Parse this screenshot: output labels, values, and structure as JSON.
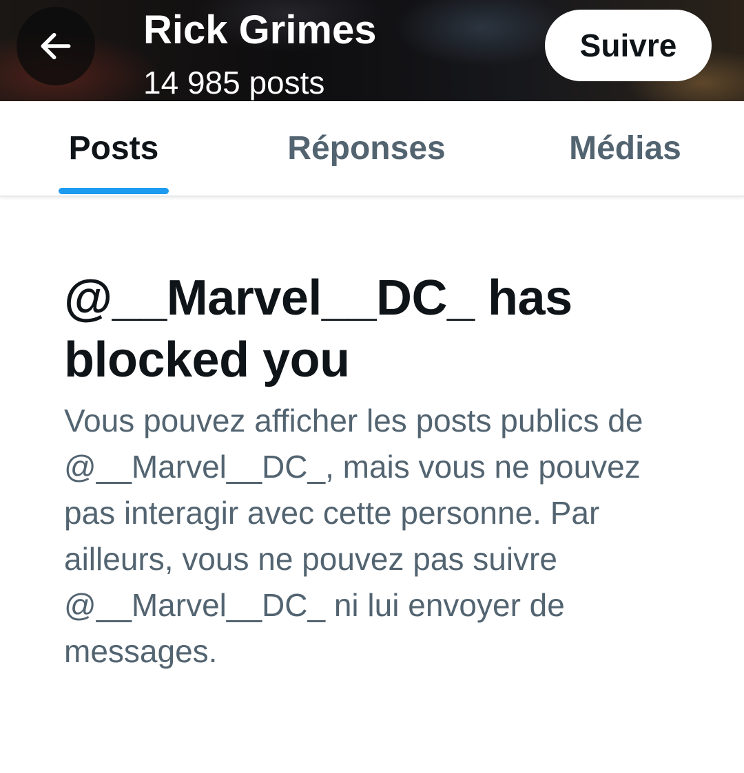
{
  "header": {
    "back_icon": "arrow-left-icon",
    "title": "Rick Grimes",
    "post_count": "14 985 posts",
    "follow_label": "Suivre"
  },
  "tabs": [
    {
      "label": "Posts",
      "active": true
    },
    {
      "label": "Réponses",
      "active": false
    },
    {
      "label": "Médias",
      "active": false
    }
  ],
  "blocked": {
    "title": "@__Marvel__DC_ has blocked you",
    "description": "Vous pouvez afficher les posts publics de @__Marvel__DC_, mais vous ne pouvez pas interagir avec cette personne. Par ailleurs, vous ne pouvez pas suivre @__Marvel__DC_ ni lui envoyer de messages."
  },
  "colors": {
    "accent": "#1d9bf0",
    "text_primary": "#0f1419",
    "text_secondary": "#536471"
  }
}
